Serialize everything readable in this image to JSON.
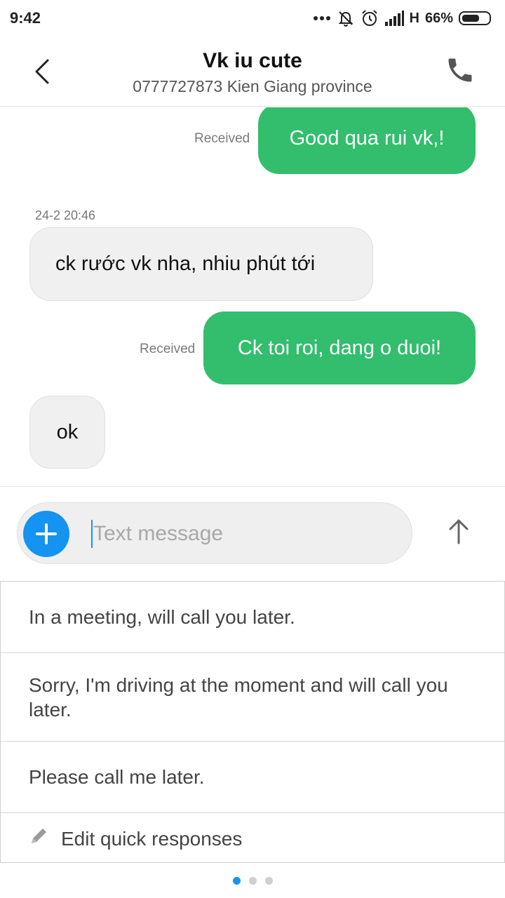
{
  "status_bar": {
    "time": "9:42",
    "network": "H",
    "battery": "66%",
    "battery_level": 0.66
  },
  "header": {
    "contact_name": "Vk iu cute",
    "contact_detail": "0777727873 Kien Giang province"
  },
  "messages": [
    {
      "direction": "sent",
      "text": "Good qua rui vk,!",
      "status": "Received"
    },
    {
      "direction": "received",
      "timestamp": "24-2 20:46",
      "text": "ck rước vk nha,  nhiu phút tới"
    },
    {
      "direction": "sent",
      "text": "Ck toi roi, dang o duoi!",
      "status": "Received"
    },
    {
      "direction": "received",
      "text": "ok"
    }
  ],
  "composer": {
    "placeholder": "Text message",
    "value": ""
  },
  "quick_responses": [
    "In a meeting, will call you later.",
    "Sorry, I'm driving at the moment and will call you later.",
    "Please call me later.",
    "Edit quick responses"
  ],
  "pager": {
    "pages": 3,
    "active": 1
  },
  "colors": {
    "sent_bubble": "#32be6d",
    "received_bubble": "#f0f0f0",
    "accent": "#1593f0"
  },
  "icons": {
    "back": "chevron-left-icon",
    "call": "phone-icon",
    "add": "plus-icon",
    "send": "arrow-up-icon",
    "edit": "pencil-icon"
  }
}
